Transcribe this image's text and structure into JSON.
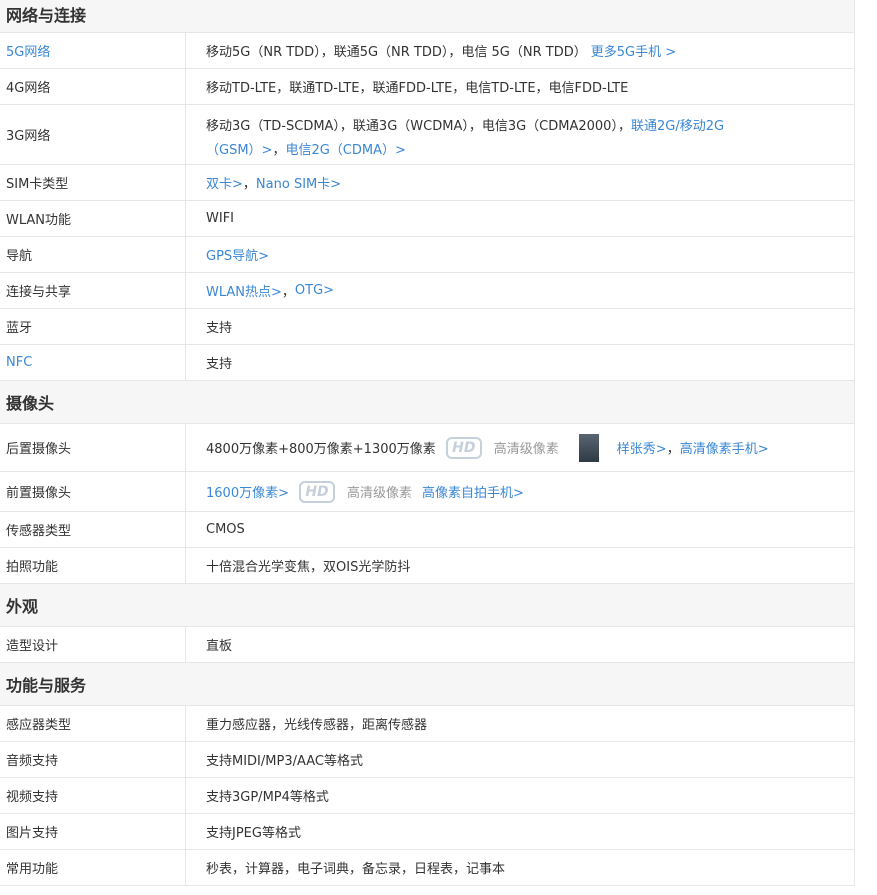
{
  "sections": {
    "network": "网络与连接",
    "camera": "摄像头",
    "appearance": "外观",
    "features": "功能与服务"
  },
  "net": {
    "g5": {
      "k": "5G网络",
      "v": "移动5G（NR TDD），联通5G（NR TDD），电信 5G（NR TDD）",
      "link": "更多5G手机 >"
    },
    "g4": {
      "k": "4G网络",
      "v": "移动TD-LTE，联通TD-LTE，联通FDD-LTE，电信TD-LTE，电信FDD-LTE"
    },
    "g3": {
      "k": "3G网络",
      "v": "移动3G（TD-SCDMA），联通3G（WCDMA），电信3G（CDMA2000），",
      "link1": "联通2G/移动2G（GSM）>",
      "link2": "电信2G（CDMA）>"
    },
    "sim": {
      "k": "SIM卡类型",
      "l1": "双卡>",
      "l2": "Nano SIM卡>"
    },
    "wlan": {
      "k": "WLAN功能",
      "v": "WIFI"
    },
    "nav": {
      "k": "导航",
      "l1": "GPS导航>"
    },
    "share": {
      "k": "连接与共享",
      "l1": "WLAN热点>",
      "l2": "OTG>"
    },
    "bt": {
      "k": "蓝牙",
      "v": "支持"
    },
    "nfc": {
      "k": "NFC",
      "v": "支持"
    }
  },
  "cam": {
    "rear": {
      "k": "后置摄像头",
      "v": "4800万像素+800万像素+1300万像素",
      "hd": "HD",
      "hdtext": "高清级像素",
      "l1": "样张秀>",
      "l2": "高清像素手机>"
    },
    "front": {
      "k": "前置摄像头",
      "l0": "1600万像素>",
      "hd": "HD",
      "hdtext": "高清级像素",
      "l1": "高像素自拍手机>"
    },
    "sensor": {
      "k": "传感器类型",
      "v": "CMOS"
    },
    "photo": {
      "k": "拍照功能",
      "v": "十倍混合光学变焦，双OIS光学防抖"
    }
  },
  "look": {
    "design": {
      "k": "造型设计",
      "v": "直板"
    }
  },
  "func": {
    "sensors": {
      "k": "感应器类型",
      "v": "重力感应器，光线传感器，距离传感器"
    },
    "audio": {
      "k": "音频支持",
      "v": "支持MIDI/MP3/AAC等格式"
    },
    "video": {
      "k": "视频支持",
      "v": "支持3GP/MP4等格式"
    },
    "image": {
      "k": "图片支持",
      "v": "支持JPEG等格式"
    },
    "common": {
      "k": "常用功能",
      "v": "秒表，计算器，电子词典，备忘录，日程表，记事本"
    }
  },
  "colors": {
    "link": "#3a87d6",
    "section_bg": "#f6f6f6",
    "border": "#e6e6e6"
  }
}
